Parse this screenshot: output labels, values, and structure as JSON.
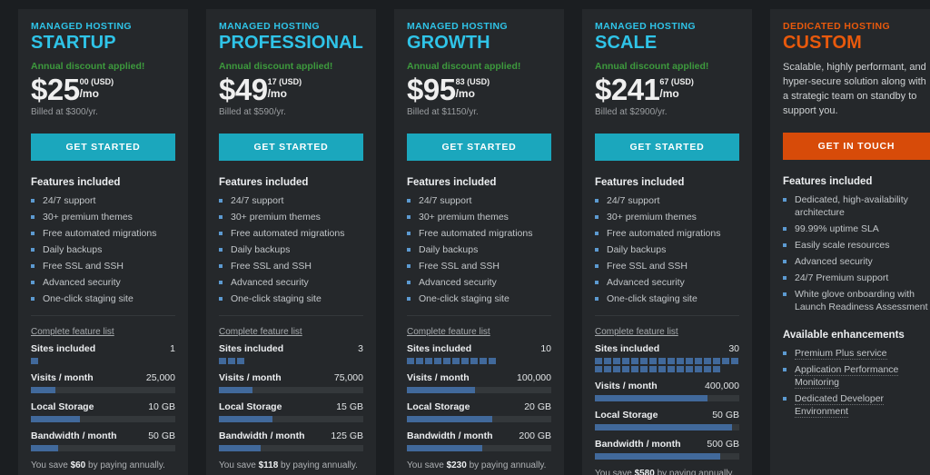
{
  "colors": {
    "page_bg": "#1b1e21",
    "card_bg": "#25282b",
    "accent_teal": "#2fc4e8",
    "accent_orange": "#e8590c",
    "button_teal": "#1ba7bd",
    "button_orange": "#d74b09",
    "discount_green": "#3d9a3d",
    "bar_fill": "#41699b",
    "bar_track": "#34383b",
    "bullet": "#5c9ad1"
  },
  "plans": [
    {
      "kicker": "MANAGED HOSTING",
      "name": "STARTUP",
      "discount": "Annual discount applied!",
      "price_main": "$25",
      "price_cents": "00 (USD)",
      "price_per": "/mo",
      "billed": "Billed at $300/yr.",
      "cta": "GET STARTED",
      "features_heading": "Features included",
      "features": [
        "24/7 support",
        "30+ premium themes",
        "Free automated migrations",
        "Daily backups",
        "Free SSL and SSH",
        "Advanced security",
        "One-click staging site"
      ],
      "feature_link": "Complete feature list",
      "metrics": [
        {
          "label": "Sites included",
          "value": "1",
          "type": "segments",
          "segments": 1
        },
        {
          "label": "Visits / month",
          "value": "25,000",
          "type": "bar",
          "fill_pct": 17
        },
        {
          "label": "Local Storage",
          "value": "10 GB",
          "type": "bar",
          "fill_pct": 34
        },
        {
          "label": "Bandwidth / month",
          "value": "50 GB",
          "type": "bar",
          "fill_pct": 19
        }
      ],
      "save_prefix": "You save ",
      "save_amount": "$60",
      "save_suffix": " by paying annually."
    },
    {
      "kicker": "MANAGED HOSTING",
      "name": "PROFESSIONAL",
      "discount": "Annual discount applied!",
      "price_main": "$49",
      "price_cents": "17 (USD)",
      "price_per": "/mo",
      "billed": "Billed at $590/yr.",
      "cta": "GET STARTED",
      "features_heading": "Features included",
      "features": [
        "24/7 support",
        "30+ premium themes",
        "Free automated migrations",
        "Daily backups",
        "Free SSL and SSH",
        "Advanced security",
        "One-click staging site"
      ],
      "feature_link": "Complete feature list",
      "metrics": [
        {
          "label": "Sites included",
          "value": "3",
          "type": "segments",
          "segments": 3
        },
        {
          "label": "Visits / month",
          "value": "75,000",
          "type": "bar",
          "fill_pct": 23
        },
        {
          "label": "Local Storage",
          "value": "15 GB",
          "type": "bar",
          "fill_pct": 37
        },
        {
          "label": "Bandwidth / month",
          "value": "125 GB",
          "type": "bar",
          "fill_pct": 29
        }
      ],
      "save_prefix": "You save ",
      "save_amount": "$118",
      "save_suffix": " by paying annually."
    },
    {
      "kicker": "MANAGED HOSTING",
      "name": "GROWTH",
      "discount": "Annual discount applied!",
      "price_main": "$95",
      "price_cents": "83 (USD)",
      "price_per": "/mo",
      "billed": "Billed at $1150/yr.",
      "cta": "GET STARTED",
      "features_heading": "Features included",
      "features": [
        "24/7 support",
        "30+ premium themes",
        "Free automated migrations",
        "Daily backups",
        "Free SSL and SSH",
        "Advanced security",
        "One-click staging site"
      ],
      "feature_link": "Complete feature list",
      "metrics": [
        {
          "label": "Sites included",
          "value": "10",
          "type": "segments",
          "segments": 10
        },
        {
          "label": "Visits / month",
          "value": "100,000",
          "type": "bar",
          "fill_pct": 47
        },
        {
          "label": "Local Storage",
          "value": "20 GB",
          "type": "bar",
          "fill_pct": 59
        },
        {
          "label": "Bandwidth / month",
          "value": "200 GB",
          "type": "bar",
          "fill_pct": 52
        }
      ],
      "save_prefix": "You save ",
      "save_amount": "$230",
      "save_suffix": " by paying annually."
    },
    {
      "kicker": "MANAGED HOSTING",
      "name": "SCALE",
      "discount": "Annual discount applied!",
      "price_main": "$241",
      "price_cents": "67 (USD)",
      "price_per": "/mo",
      "billed": "Billed at $2900/yr.",
      "cta": "GET STARTED",
      "features_heading": "Features included",
      "features": [
        "24/7 support",
        "30+ premium themes",
        "Free automated migrations",
        "Daily backups",
        "Free SSL and SSH",
        "Advanced security",
        "One-click staging site"
      ],
      "feature_link": "Complete feature list",
      "metrics": [
        {
          "label": "Sites included",
          "value": "30",
          "type": "segments",
          "segments": 30
        },
        {
          "label": "Visits / month",
          "value": "400,000",
          "type": "bar",
          "fill_pct": 78
        },
        {
          "label": "Local Storage",
          "value": "50 GB",
          "type": "bar",
          "fill_pct": 95
        },
        {
          "label": "Bandwidth / month",
          "value": "500 GB",
          "type": "bar",
          "fill_pct": 87
        }
      ],
      "save_prefix": "You save ",
      "save_amount": "$580",
      "save_suffix": " by paying annually."
    }
  ],
  "custom": {
    "kicker": "DEDICATED HOSTING",
    "name": "CUSTOM",
    "description": "Scalable, highly performant, and hyper-secure solution along with a strategic team on standby to support you.",
    "cta": "GET IN TOUCH",
    "features_heading": "Features included",
    "features": [
      "Dedicated, high-availability architecture",
      "99.99% uptime SLA",
      "Easily scale resources",
      "Advanced security",
      "24/7 Premium support",
      "White glove onboarding with Launch Readiness Assessment"
    ],
    "enhancements_heading": "Available enhancements",
    "enhancements": [
      "Premium Plus service",
      "Application Performance Monitoring",
      "Dedicated Developer Environment"
    ]
  }
}
